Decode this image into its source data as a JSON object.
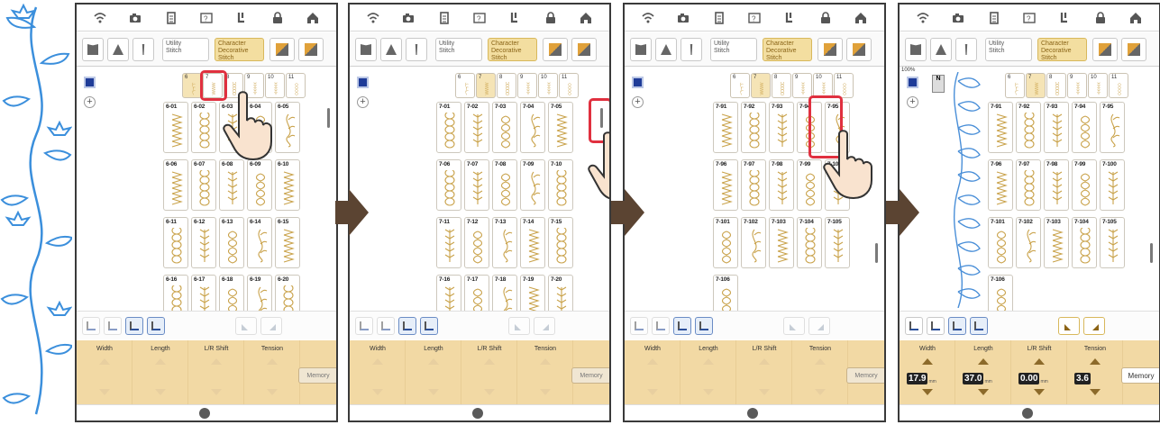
{
  "toolbar": {
    "utility_label": "Utility\nStitch",
    "character_label": "Character\nDecorative\nStitch"
  },
  "icons": [
    "wifi-icon",
    "camera-icon",
    "document-icon",
    "help-icon",
    "presser-foot-icon",
    "lock-icon",
    "home-icon"
  ],
  "zoom": "100%",
  "foot_label": "N",
  "tabs": [
    {
      "n": "6"
    },
    {
      "n": "7"
    },
    {
      "n": "8"
    },
    {
      "n": "9"
    },
    {
      "n": "10"
    },
    {
      "n": "11"
    }
  ],
  "screens": [
    {
      "sel_tab": 0,
      "rows": [
        [
          "6-01",
          "6-02",
          "6-03",
          "6-04",
          "6-05"
        ],
        [
          "6-06",
          "6-07",
          "6-08",
          "6-09",
          "6-10"
        ],
        [
          "6-11",
          "6-12",
          "6-13",
          "6-14",
          "6-15"
        ],
        [
          "6-16",
          "6-17",
          "6-18",
          "6-19",
          "6-20"
        ]
      ]
    },
    {
      "sel_tab": 1,
      "rows": [
        [
          "7-01",
          "7-02",
          "7-03",
          "7-04",
          "7-05"
        ],
        [
          "7-06",
          "7-07",
          "7-08",
          "7-09",
          "7-10"
        ],
        [
          "7-11",
          "7-12",
          "7-13",
          "7-14",
          "7-15"
        ],
        [
          "7-16",
          "7-17",
          "7-18",
          "7-19",
          "7-20"
        ]
      ]
    },
    {
      "sel_tab": 1,
      "rows": [
        [
          "7-91",
          "7-92",
          "7-93",
          "7-94",
          "7-95"
        ],
        [
          "7-96",
          "7-97",
          "7-98",
          "7-99",
          "7-100"
        ],
        [
          "7-101",
          "7-102",
          "7-103",
          "7-104",
          "7-105"
        ],
        [
          "7-106"
        ]
      ]
    },
    {
      "sel_tab": 1,
      "rows": [
        [
          "7-91",
          "7-92",
          "7-93",
          "7-94",
          "7-95"
        ],
        [
          "7-96",
          "7-97",
          "7-98",
          "7-99",
          "7-100"
        ],
        [
          "7-101",
          "7-102",
          "7-103",
          "7-104",
          "7-105"
        ],
        [
          "7-106"
        ]
      ]
    }
  ],
  "params": {
    "width": "Width",
    "length": "Length",
    "shift": "L/R Shift",
    "tension": "Tension"
  },
  "values": {
    "width": "17.9",
    "length": "37.0",
    "shift": "0.00",
    "tension": "3.6",
    "unit": "mm"
  },
  "memory": "Memory",
  "colors": {
    "frame": "#3a3a3a",
    "arrow": "#5b4432",
    "gold": "#f2d9a4",
    "highlight": "#e0303f",
    "blue_stitch": "#4a8fd8",
    "stitch": "#c9a24a"
  }
}
